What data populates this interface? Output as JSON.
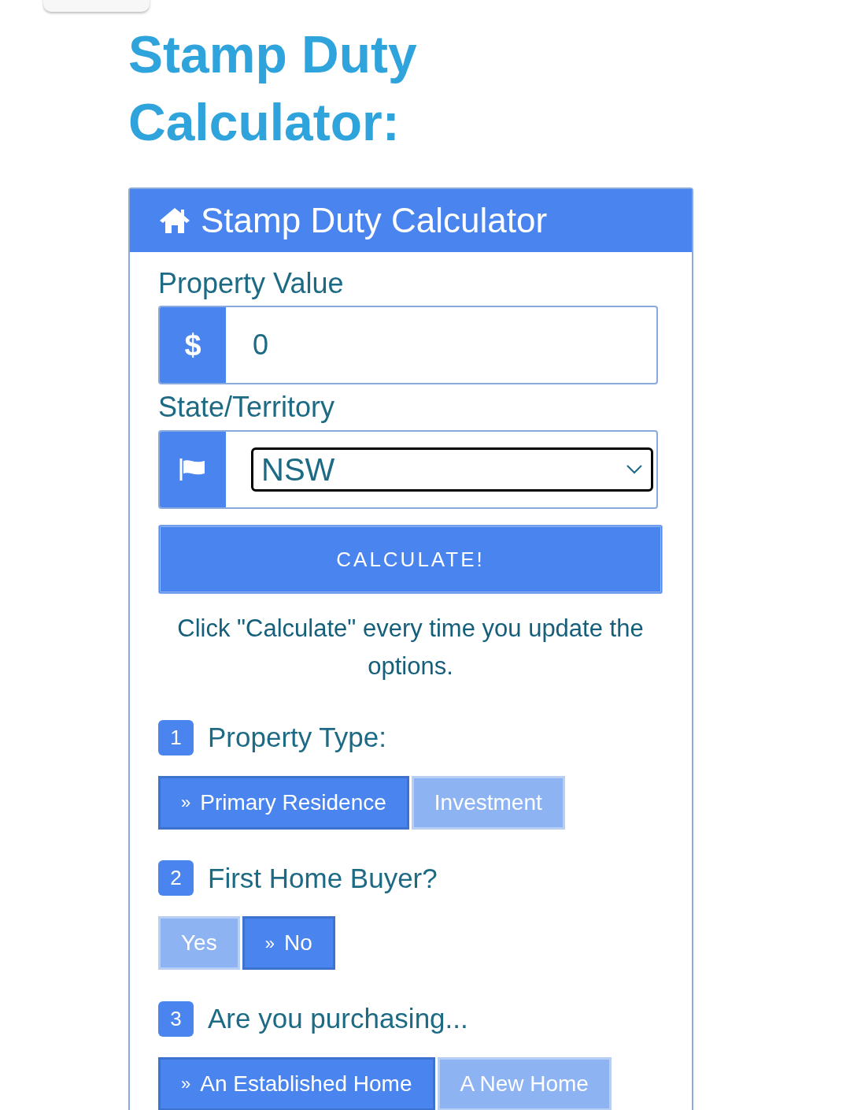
{
  "page_title": "Stamp Duty Calculator:",
  "card": {
    "title": "Stamp Duty Calculator"
  },
  "property_value": {
    "label": "Property Value",
    "prefix": "$",
    "value": "0"
  },
  "state": {
    "label": "State/Territory",
    "value": "NSW"
  },
  "calculate_button": "CALCULATE!",
  "hint": "Click \"Calculate\" every time you update the options.",
  "questions": [
    {
      "number": "1",
      "label": "Property Type:",
      "marker": "»",
      "options": [
        {
          "label": "Primary Residence",
          "selected": true
        },
        {
          "label": "Investment",
          "selected": false
        }
      ]
    },
    {
      "number": "2",
      "label": "First Home Buyer?",
      "marker": "»",
      "options": [
        {
          "label": "Yes",
          "selected": false
        },
        {
          "label": "No",
          "selected": true
        }
      ]
    },
    {
      "number": "3",
      "label": "Are you purchasing...",
      "marker": "»",
      "options": [
        {
          "label": "An Established Home",
          "selected": true
        },
        {
          "label": "A New Home",
          "selected": false
        }
      ]
    }
  ]
}
